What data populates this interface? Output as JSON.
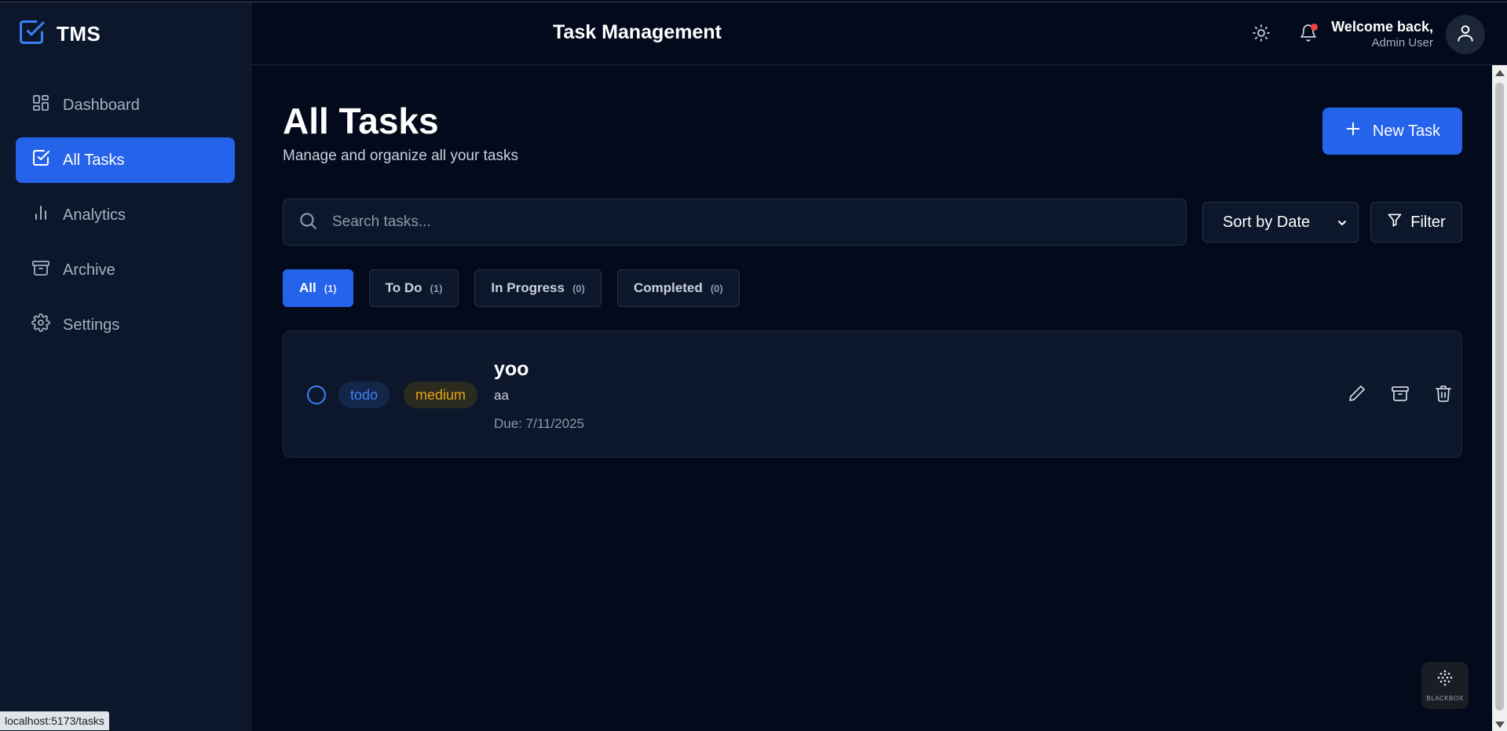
{
  "brand": {
    "name": "TMS",
    "icon": "checkbox-icon"
  },
  "sidebar": {
    "items": [
      {
        "label": "Dashboard",
        "icon": "dashboard-icon",
        "active": false
      },
      {
        "label": "All Tasks",
        "icon": "checkbox-icon",
        "active": true
      },
      {
        "label": "Analytics",
        "icon": "bar-chart-icon",
        "active": false
      },
      {
        "label": "Archive",
        "icon": "archive-icon",
        "active": false
      },
      {
        "label": "Settings",
        "icon": "gear-icon",
        "active": false
      }
    ]
  },
  "header": {
    "title": "Task Management",
    "welcome": "Welcome back,",
    "user_name": "Admin User"
  },
  "main": {
    "title": "All Tasks",
    "subtitle": "Manage and organize all your tasks",
    "new_task_label": "New Task",
    "search_placeholder": "Search tasks...",
    "sort_label": "Sort by Date",
    "filter_label": "Filter",
    "tabs": [
      {
        "label": "All",
        "count": "(1)",
        "active": true
      },
      {
        "label": "To Do",
        "count": "(1)",
        "active": false
      },
      {
        "label": "In Progress",
        "count": "(0)",
        "active": false
      },
      {
        "label": "Completed",
        "count": "(0)",
        "active": false
      }
    ],
    "tasks": [
      {
        "status": "todo",
        "priority": "medium",
        "title": "yoo",
        "description": "aa",
        "due": "Due: 7/11/2025"
      }
    ]
  },
  "browser": {
    "status_url": "localhost:5173/tasks",
    "extension_label": "BLACKBOX"
  },
  "colors": {
    "accent": "#2563eb",
    "background": "#030a1c",
    "sidebar": "#0c172c",
    "notification": "#ef4444",
    "priority_medium": "#e8a317",
    "status_todo": "#3b82f6"
  }
}
